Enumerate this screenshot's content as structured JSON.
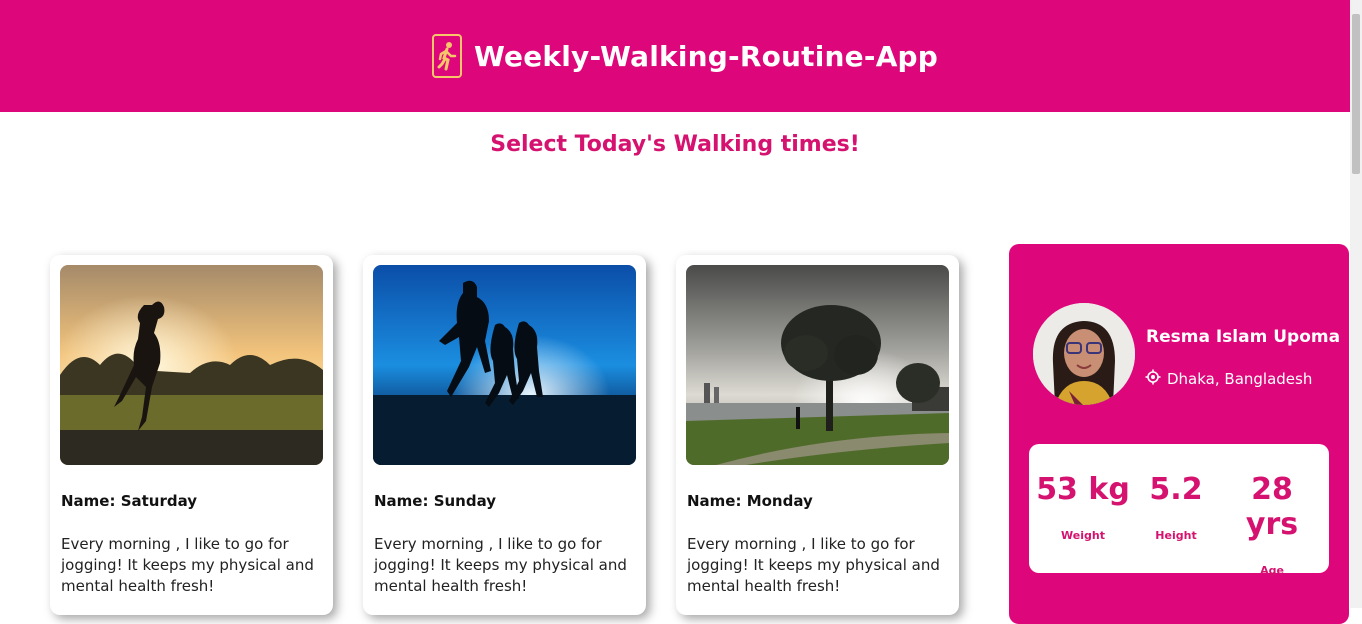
{
  "header": {
    "title": "Weekly-Walking-Routine-App",
    "icon": "walking-person-icon"
  },
  "subtitle": "Select Today's Walking times!",
  "cards": [
    {
      "name": "Name: Saturday",
      "description": "Every morning , I like to go for jogging! It keeps my physical and mental health fresh!",
      "image": "woman-jogging-sunset"
    },
    {
      "name": "Name: Sunday",
      "description": "Every morning , I like to go for jogging! It keeps my physical and mental health fresh!",
      "image": "runners-silhouette-blue"
    },
    {
      "name": "Name: Monday",
      "description": "Every morning , I like to go for jogging! It keeps my physical and mental health fresh!",
      "image": "park-tree-sunrise"
    }
  ],
  "profile": {
    "name": "Resma Islam Upoma",
    "location": "Dhaka, Bangladesh",
    "stats": [
      {
        "value": "53 kg",
        "label": "Weight"
      },
      {
        "value": "5.2",
        "label": "Height"
      },
      {
        "value": "28 yrs",
        "label": "Age"
      }
    ]
  },
  "colors": {
    "brand": "#dd067a",
    "accent": "#d5126f",
    "logo_outline": "#f5c76a"
  }
}
